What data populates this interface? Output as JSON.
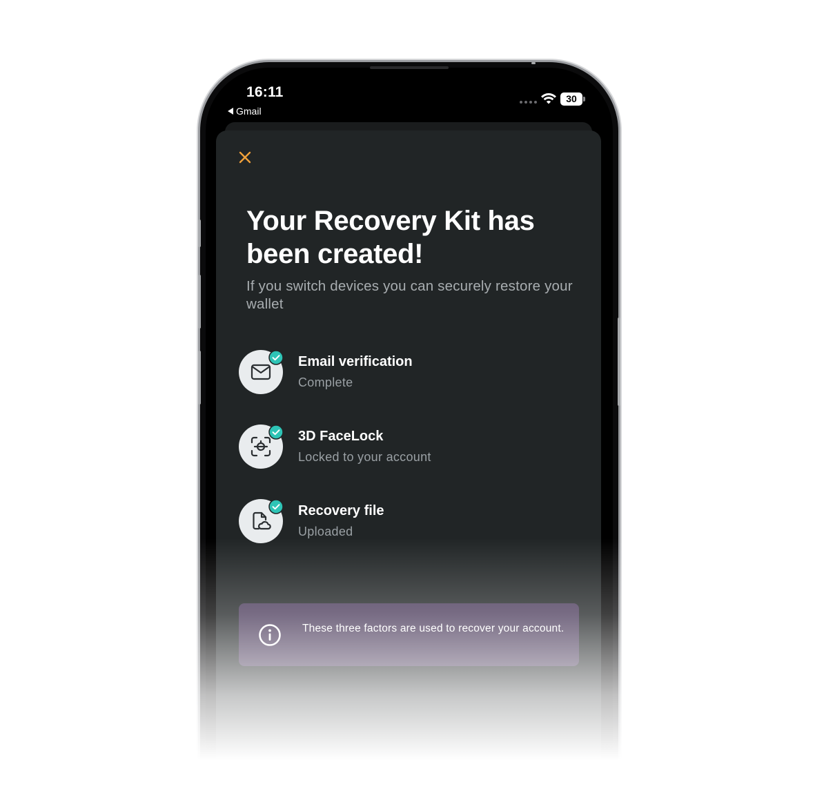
{
  "status_bar": {
    "time": "16:11",
    "back_app": "Gmail",
    "battery": "30",
    "icons": [
      "signal-dots",
      "wifi-icon",
      "battery-icon"
    ]
  },
  "sheet": {
    "close_icon": "close-icon",
    "title": "Your Recovery Kit has been created!",
    "subtitle": "If you switch devices you can securely restore your wallet"
  },
  "factors": [
    {
      "title": "Email verification",
      "status": "Complete",
      "icon": "mail-icon"
    },
    {
      "title": "3D FaceLock",
      "status": "Locked to your account",
      "icon": "face-scan-icon"
    },
    {
      "title": "Recovery file",
      "status": "Uploaded",
      "icon": "cloud-file-icon"
    }
  ],
  "info": {
    "text": "These three factors are used to recover your account.",
    "icon": "info-icon"
  },
  "colors": {
    "sheet_bg": "#212526",
    "accent_close": "#f0a13a",
    "check_teal": "#2ec4b6",
    "info_bg": "#4b3b5b"
  }
}
